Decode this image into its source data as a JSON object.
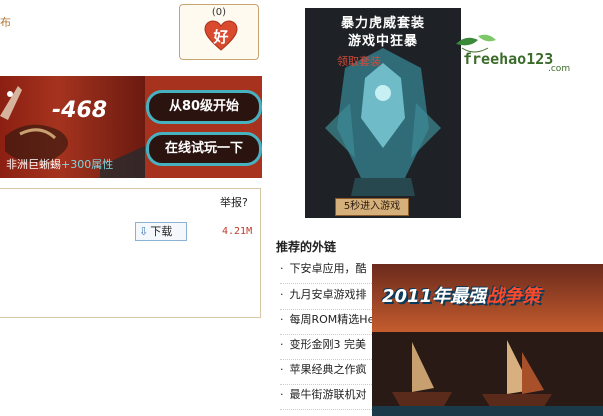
{
  "header": {
    "cut_text": "布"
  },
  "like": {
    "count": "(0)",
    "label": "好"
  },
  "banner": {
    "number": "-468",
    "caption_name": "非洲巨蜥蜴",
    "caption_extra": "+300属性",
    "btn_start": "从80级开始",
    "btn_play": "在线试玩一下"
  },
  "file": {
    "report_label": "举报?",
    "download_label": "下载",
    "size": "4.21M"
  },
  "ad1": {
    "title_line1": "暴力虎威套装",
    "title_line2": "游戏中狂暴",
    "subtitle": "领取套装",
    "button": "5秒进入游戏"
  },
  "logo": {
    "text": "freehao123",
    "suffix": ".com"
  },
  "links": {
    "title": "推荐的外链",
    "items": [
      "下安卓应用，酷",
      "九月安卓游戏排",
      "每周ROM精选Her",
      "变形金刚3 完美",
      "苹果经典之作疯",
      "最牛街游联机对"
    ]
  },
  "ad2": {
    "title_a": "2011年最强",
    "title_b": "战争策"
  },
  "colors": {
    "accent_teal": "#48b1c0",
    "brand_red": "#a5331e",
    "size_red": "#c0392b"
  }
}
